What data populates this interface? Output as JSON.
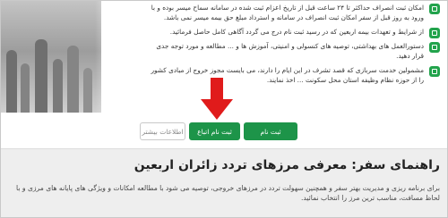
{
  "hero": {
    "items": [
      {
        "icon": "calendar-icon",
        "text": "امکان ثبت انصراف حداکثر تا ۲۴ ساعت قبل از تاریخ اعزام ثبت شده در سامانه سماح میسر بوده و با ورود به روز قبل از سفر امکان ثبت انصراف در سامانه و استرداد مبلغ حق بیمه میسر نمی باشد."
      },
      {
        "icon": "document-icon",
        "text": "از شرایط و تعهدات بیمه اربعین که در رسید ثبت نام درج می گردد آگاهی کامل حاصل فرمائید."
      },
      {
        "icon": "book-icon",
        "text": "دستورالعمل های بهداشتی، توصیه های کنسولی و امنیتی، آموزش ها و ... مطالعه و مورد توجه جدی قرار دهید."
      },
      {
        "icon": "people-icon",
        "text": "مشمولین خدمت سربازی که قصد تشرف در این ایام را دارند، می بایست مجوز خروج از مبادی کشور را از حوزه نظام وظیفه استان محل سکونت ... اخذ نمایند."
      }
    ]
  },
  "buttons": {
    "register": "ثبت نام",
    "register_followers": "ثبت نام اتباع",
    "more_info": "اطلاعات بیشتر"
  },
  "guide": {
    "title": "راهنمای سفر: معرفی مرزهای تردد زائران اربعین",
    "body": "برای برنامه ریزی و مدیریت بهتر سفر و همچنین سهولت تردد در مرزهای خروجی، توصیه می شود با مطالعه امکانات و ویژگی های پایانه های مرزی و با لحاظ مسافت، مناسب ترین مرز را انتخاب نمائید."
  },
  "colors": {
    "accent": "#1d9449",
    "arrow": "#e01b1b",
    "guide_background": "#eeeeee"
  }
}
